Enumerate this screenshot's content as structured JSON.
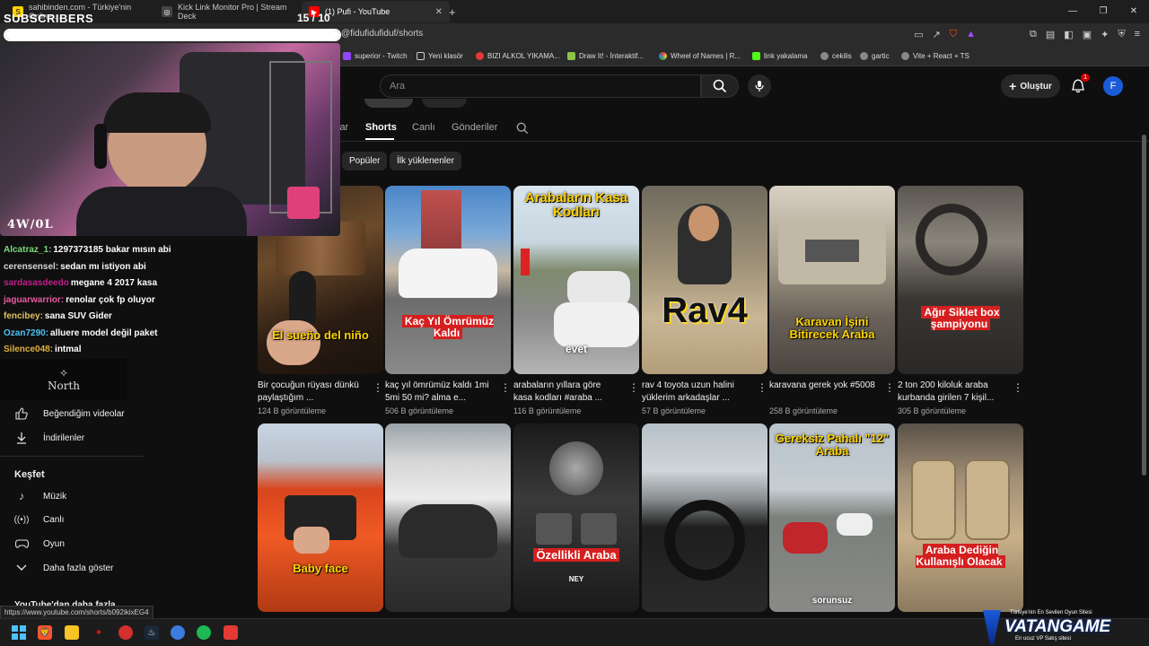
{
  "browser": {
    "tabs": [
      {
        "label": "sahibinden.com - Türkiye'nin Online ..."
      },
      {
        "label": "Kick Link Monitor Pro | Stream Deck"
      },
      {
        "label": "(1) Pufi - YouTube"
      }
    ],
    "url": "@fidufidufiduf/shorts",
    "bookmarks": [
      "superior - Twitch",
      "Yeni klasör",
      "BIZI ALKOL YIKAMA...",
      "Draw It! - İnteraktif...",
      "Wheel of Names | R...",
      "link yakalama",
      "cekilis",
      "gartic",
      "Vite + React + TS"
    ],
    "status_url": "https://www.youtube.com/shorts/b092ikixEG4"
  },
  "youtube": {
    "search_placeholder": "Ara",
    "create_label": "Oluştur",
    "notif_count": "1",
    "avatar_letter": "F"
  },
  "channel": {
    "tabs": [
      {
        "label": "lar",
        "active": false
      },
      {
        "label": "Shorts",
        "active": true
      },
      {
        "label": "Canlı",
        "active": false
      },
      {
        "label": "Gönderiler",
        "active": false
      }
    ],
    "chips": [
      "Popüler",
      "İlk yüklenenler"
    ]
  },
  "sidebar": {
    "items": [
      {
        "label": "Beğendiğim videolar",
        "icon": "thumbs-up-icon"
      },
      {
        "label": "İndirilenler",
        "icon": "download-icon"
      }
    ],
    "explore_heading": "Keşfet",
    "explore_items": [
      {
        "label": "Müzik",
        "icon": "music-note-icon"
      },
      {
        "label": "Canlı",
        "icon": "live-icon"
      },
      {
        "label": "Oyun",
        "icon": "game-controller-icon"
      },
      {
        "label": "Daha fazla göster",
        "icon": "chevron-down-icon"
      }
    ],
    "more_heading": "YouTube'dan daha fazla"
  },
  "shorts_row1": [
    {
      "caption": "El sueño del niño",
      "title": "Bir çocuğun rüyası dünkü paylaştığım ...",
      "views": "124 B görüntüleme"
    },
    {
      "caption": "Kaç Yıl Ömrümüz Kaldı",
      "title": "kaç yıl ömrümüz kaldı 1mi 5mi 50 mi? alma e...",
      "views": "506 B görüntüleme"
    },
    {
      "caption": "Arabaların Kasa Kodları",
      "caption2": "evet",
      "title": "arabaların yıllara göre kasa kodları #araba ...",
      "views": "116 B görüntüleme"
    },
    {
      "caption": "Rav4",
      "title": "rav 4 toyota uzun halini yüklerim arkadaşlar ...",
      "views": "57 B görüntüleme"
    },
    {
      "caption": "Karavan İşini Bitirecek Araba",
      "title": "karavana gerek yok #5008",
      "views": "258 B görüntüleme"
    },
    {
      "caption": "Ağır Siklet box şampiyonu",
      "title": "2 ton 200 kiloluk araba kurbanda girilen 7 kişil...",
      "views": "305 B görüntüleme"
    }
  ],
  "shorts_row2": [
    {
      "caption": "Baby face"
    },
    {
      "caption": ""
    },
    {
      "caption": "Özellikli Araba",
      "caption2": "NEY"
    },
    {
      "caption": ""
    },
    {
      "caption": "Gereksiz Pahalı \"12\" Araba",
      "caption2": "sorunsuz"
    },
    {
      "caption": "Araba Dediğin Kullanışlı Olacak"
    }
  ],
  "stream": {
    "subs_label": "SUBSCRIBERS",
    "subs_count": "15 / 10",
    "subs_progress": 1.0,
    "record": "4W/0L",
    "chat": [
      {
        "user": "Alcatraz_1:",
        "color": "#7dd87d",
        "msg": "1297373185 bakar mısın abi"
      },
      {
        "user": "cerensensel:",
        "color": "#d8d8d8",
        "msg": "sedan mı istiyon abi"
      },
      {
        "user": "sardasasdeedo",
        "color": "#c21e8c",
        "msg": "megane 4 2017 kasa"
      },
      {
        "user": "jaguarwarrior:",
        "color": "#e85aa0",
        "msg": "renolar çok fp oluyor"
      },
      {
        "user": "fencibey:",
        "color": "#e0c060",
        "msg": "sana SUV Gider"
      },
      {
        "user": "Ozan7290:",
        "color": "#4fc3f7",
        "msg": "alluere model değil paket"
      },
      {
        "user": "Silence048:",
        "color": "#e0b040",
        "msg": "intmal"
      }
    ],
    "north_label": "North",
    "vatan_text": "VATANGAME",
    "vatan_tag": "Türkiye'nin En Sevilen Oyun Sitesi",
    "vatan_tag2": "En ucuz VP Satış sitesi"
  }
}
